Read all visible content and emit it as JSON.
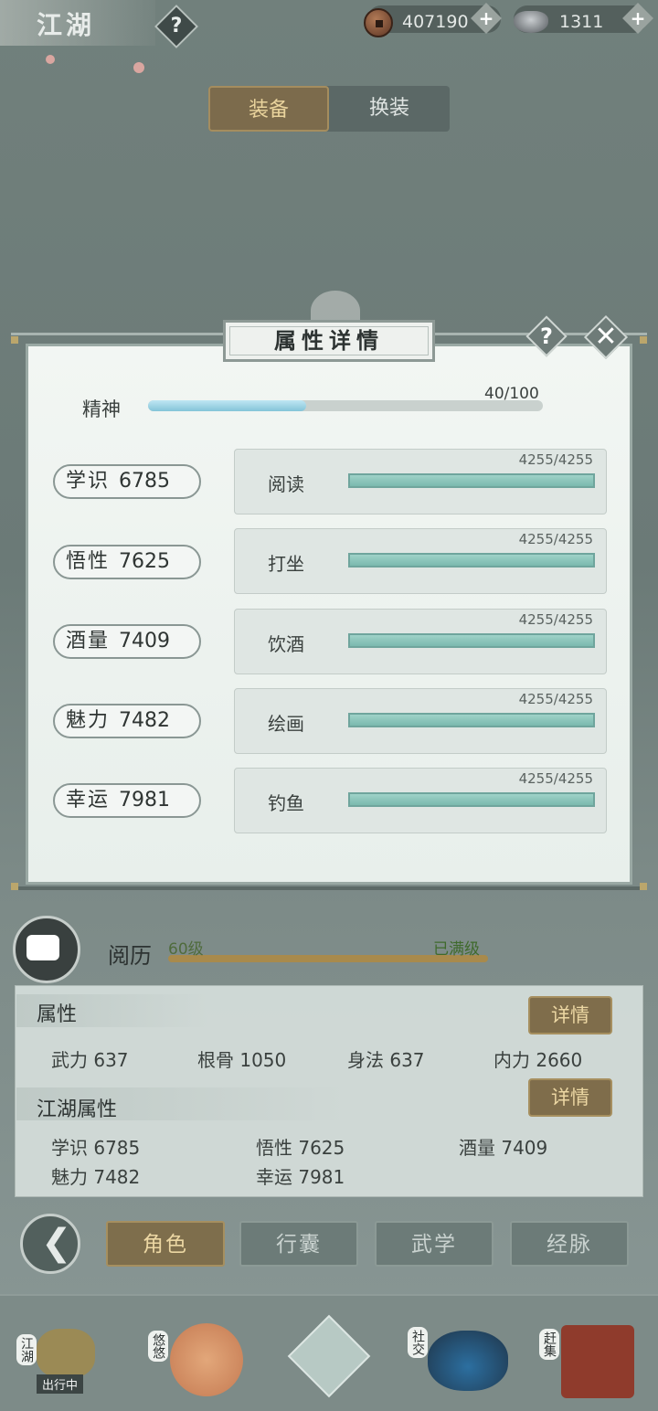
{
  "header": {
    "title": "江湖",
    "help_glyph": "?",
    "coins": "407190",
    "silver": "1311",
    "plus_glyph": "+"
  },
  "tabs": {
    "equip": "装备",
    "change": "换装"
  },
  "modal": {
    "title": "属性详情",
    "help_glyph": "?",
    "close_glyph": "✕",
    "spirit": {
      "label": "精神",
      "value_text": "40/100",
      "fraction": 0.4
    },
    "stats": [
      {
        "name": "学识",
        "value": "6785",
        "skill": "阅读",
        "progress": "4255/4255",
        "fraction": 1.0
      },
      {
        "name": "悟性",
        "value": "7625",
        "skill": "打坐",
        "progress": "4255/4255",
        "fraction": 1.0
      },
      {
        "name": "酒量",
        "value": "7409",
        "skill": "饮酒",
        "progress": "4255/4255",
        "fraction": 1.0
      },
      {
        "name": "魅力",
        "value": "7482",
        "skill": "绘画",
        "progress": "4255/4255",
        "fraction": 1.0
      },
      {
        "name": "幸运",
        "value": "7981",
        "skill": "钓鱼",
        "progress": "4255/4255",
        "fraction": 1.0
      }
    ]
  },
  "experience": {
    "label": "阅历",
    "level": "60级",
    "status": "已满级"
  },
  "attributes": {
    "title": "属性",
    "detail_label": "详情",
    "items": [
      {
        "name": "武力",
        "value": "637"
      },
      {
        "name": "根骨",
        "value": "1050"
      },
      {
        "name": "身法",
        "value": "637"
      },
      {
        "name": "内力",
        "value": "2660"
      }
    ]
  },
  "jianghu_attributes": {
    "title": "江湖属性",
    "detail_label": "详情",
    "items": [
      {
        "name": "学识",
        "value": "6785"
      },
      {
        "name": "悟性",
        "value": "7625"
      },
      {
        "name": "酒量",
        "value": "7409"
      },
      {
        "name": "魅力",
        "value": "7482"
      },
      {
        "name": "幸运",
        "value": "7981"
      }
    ]
  },
  "nav": {
    "back_glyph": "❮",
    "tabs": [
      "角色",
      "行囊",
      "武学",
      "经脉"
    ]
  },
  "dock": {
    "items": [
      {
        "label": "江湖",
        "sub": "出行中"
      },
      {
        "label": "悠悠"
      },
      {
        "label": "社交"
      },
      {
        "label": "赶集"
      }
    ]
  },
  "colors": {
    "accent_gold": "#ecd7a3",
    "teal_bar": "#7ab9ae",
    "spirit_bar": "#84c4d8"
  }
}
